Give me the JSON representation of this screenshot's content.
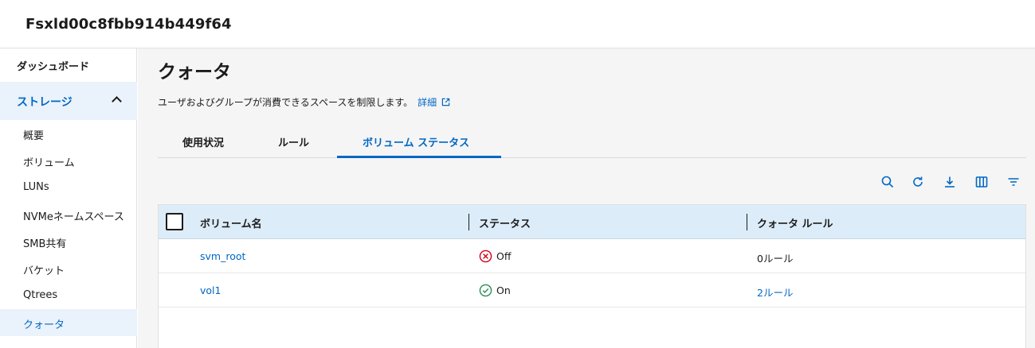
{
  "header": {
    "title": "Fsxld00c8fbb914b449f64"
  },
  "sidebar": {
    "top_item": "ダッシュボード",
    "section": {
      "label": "ストレージ",
      "expanded": true
    },
    "items": [
      "概要",
      "ボリューム",
      "LUNs",
      "NVMeネームスペース",
      "SMB共有",
      "バケット",
      "Qtrees",
      "クォータ"
    ],
    "active_item": "クォータ"
  },
  "page": {
    "title": "クォータ",
    "description": "ユーザおよびグループが消費できるスペースを制限します。",
    "details_link": "詳細"
  },
  "tabs": [
    "使用状況",
    "ルール",
    "ボリューム ステータス"
  ],
  "active_tab": "ボリューム ステータス",
  "toolbar": {
    "icons": [
      "search-icon",
      "refresh-icon",
      "download-icon",
      "columns-icon",
      "filter-icon"
    ]
  },
  "table": {
    "columns": [
      "ボリューム名",
      "ステータス",
      "クォータ ルール"
    ],
    "rows": [
      {
        "volume": "svm_root",
        "status": "Off",
        "status_icon": "x-circle-icon",
        "rules": "0ルール",
        "rules_is_link": false
      },
      {
        "volume": "vol1",
        "status": "On",
        "status_icon": "check-circle-icon",
        "rules": "2ルール",
        "rules_is_link": true
      }
    ]
  },
  "colors": {
    "accent": "#0067c5",
    "error": "#d0021b",
    "success": "#2e8b57"
  }
}
